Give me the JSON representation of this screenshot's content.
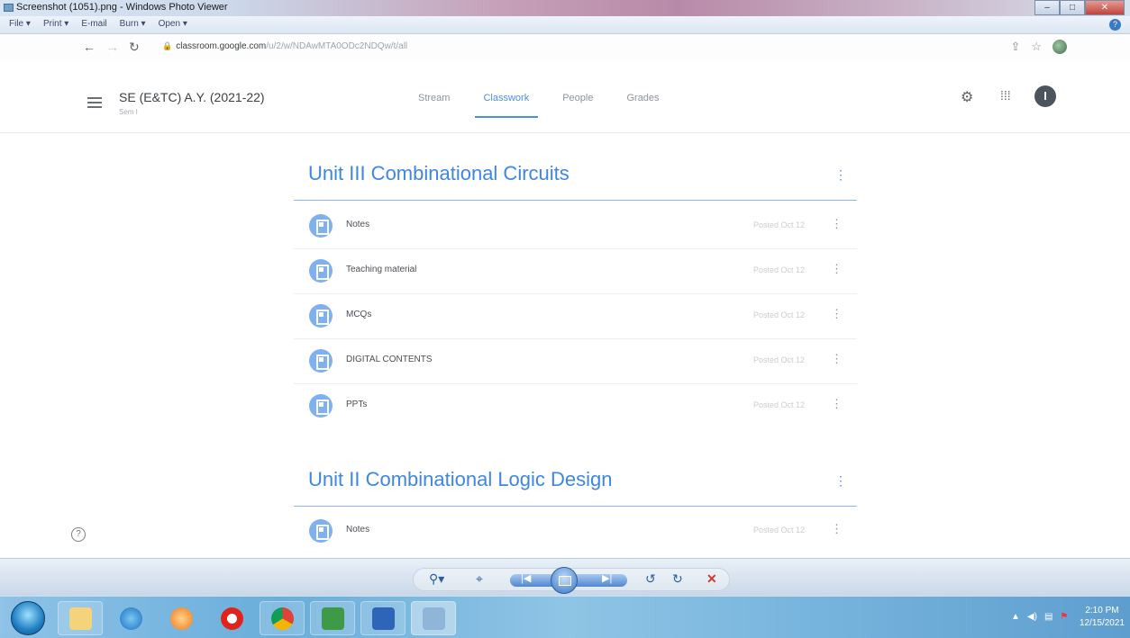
{
  "photo_viewer": {
    "window_title": "Screenshot (1051).png - Windows Photo Viewer",
    "menu": [
      "File",
      "Print",
      "E-mail",
      "Burn",
      "Open"
    ],
    "help_icon": "help-icon",
    "toolbar_buttons": [
      "zoom-icon",
      "fit-icon",
      "previous-icon",
      "slideshow-icon",
      "next-icon",
      "rotate-counterclockwise-icon",
      "rotate-clockwise-icon",
      "delete-icon"
    ]
  },
  "browser": {
    "url_host": "classroom.google.com",
    "url_path": "/u/2/w/NDAwMTA0ODc2NDQw/t/all"
  },
  "classroom": {
    "class_name": "SE (E&TC) A.Y. (2021-22)",
    "section": "Sem I",
    "tabs": [
      "Stream",
      "Classwork",
      "People",
      "Grades"
    ],
    "active_tab": "Classwork",
    "avatar_initial": "I",
    "topics": [
      {
        "title": "Unit III Combinational Circuits",
        "items": [
          {
            "label": "Notes",
            "date": "Posted Oct 12"
          },
          {
            "label": "Teaching material",
            "date": "Posted Oct 12"
          },
          {
            "label": "MCQs",
            "date": "Posted Oct 12"
          },
          {
            "label": "DIGITAL CONTENTS",
            "date": "Posted Oct 12"
          },
          {
            "label": "PPTs",
            "date": "Posted Oct 12"
          }
        ]
      },
      {
        "title": "Unit II Combinational Logic Design",
        "items": [
          {
            "label": "Notes",
            "date": "Posted Oct 12"
          }
        ]
      }
    ]
  },
  "taskbar": {
    "apps": [
      "windows-explorer",
      "internet-explorer",
      "media-player",
      "opera",
      "chrome",
      "excel",
      "word",
      "photo-viewer"
    ],
    "time": "2:10 PM",
    "date": "12/15/2021"
  },
  "colors": {
    "accent_blue": "#3f86e3",
    "taskbar": "#6aaedb"
  }
}
